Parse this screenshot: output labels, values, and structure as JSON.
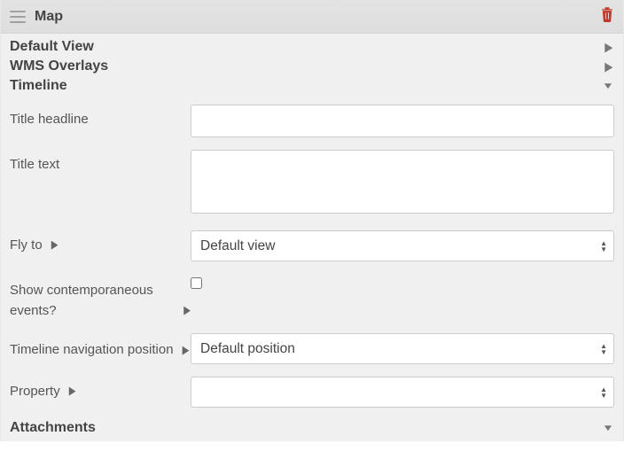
{
  "header": {
    "title": "Map"
  },
  "sections": {
    "defaultView": "Default View",
    "wmsOverlays": "WMS Overlays",
    "timeline": "Timeline",
    "attachments": "Attachments"
  },
  "form": {
    "titleHeadline": {
      "label": "Title headline",
      "value": ""
    },
    "titleText": {
      "label": "Title text",
      "value": ""
    },
    "flyTo": {
      "label": "Fly to",
      "value": "Default view"
    },
    "showContemporaneous": {
      "label": "Show contemporaneous events?",
      "checked": false
    },
    "timelineNav": {
      "label": "Timeline navigation position",
      "value": "Default position"
    },
    "property": {
      "label": "Property",
      "value": ""
    }
  }
}
